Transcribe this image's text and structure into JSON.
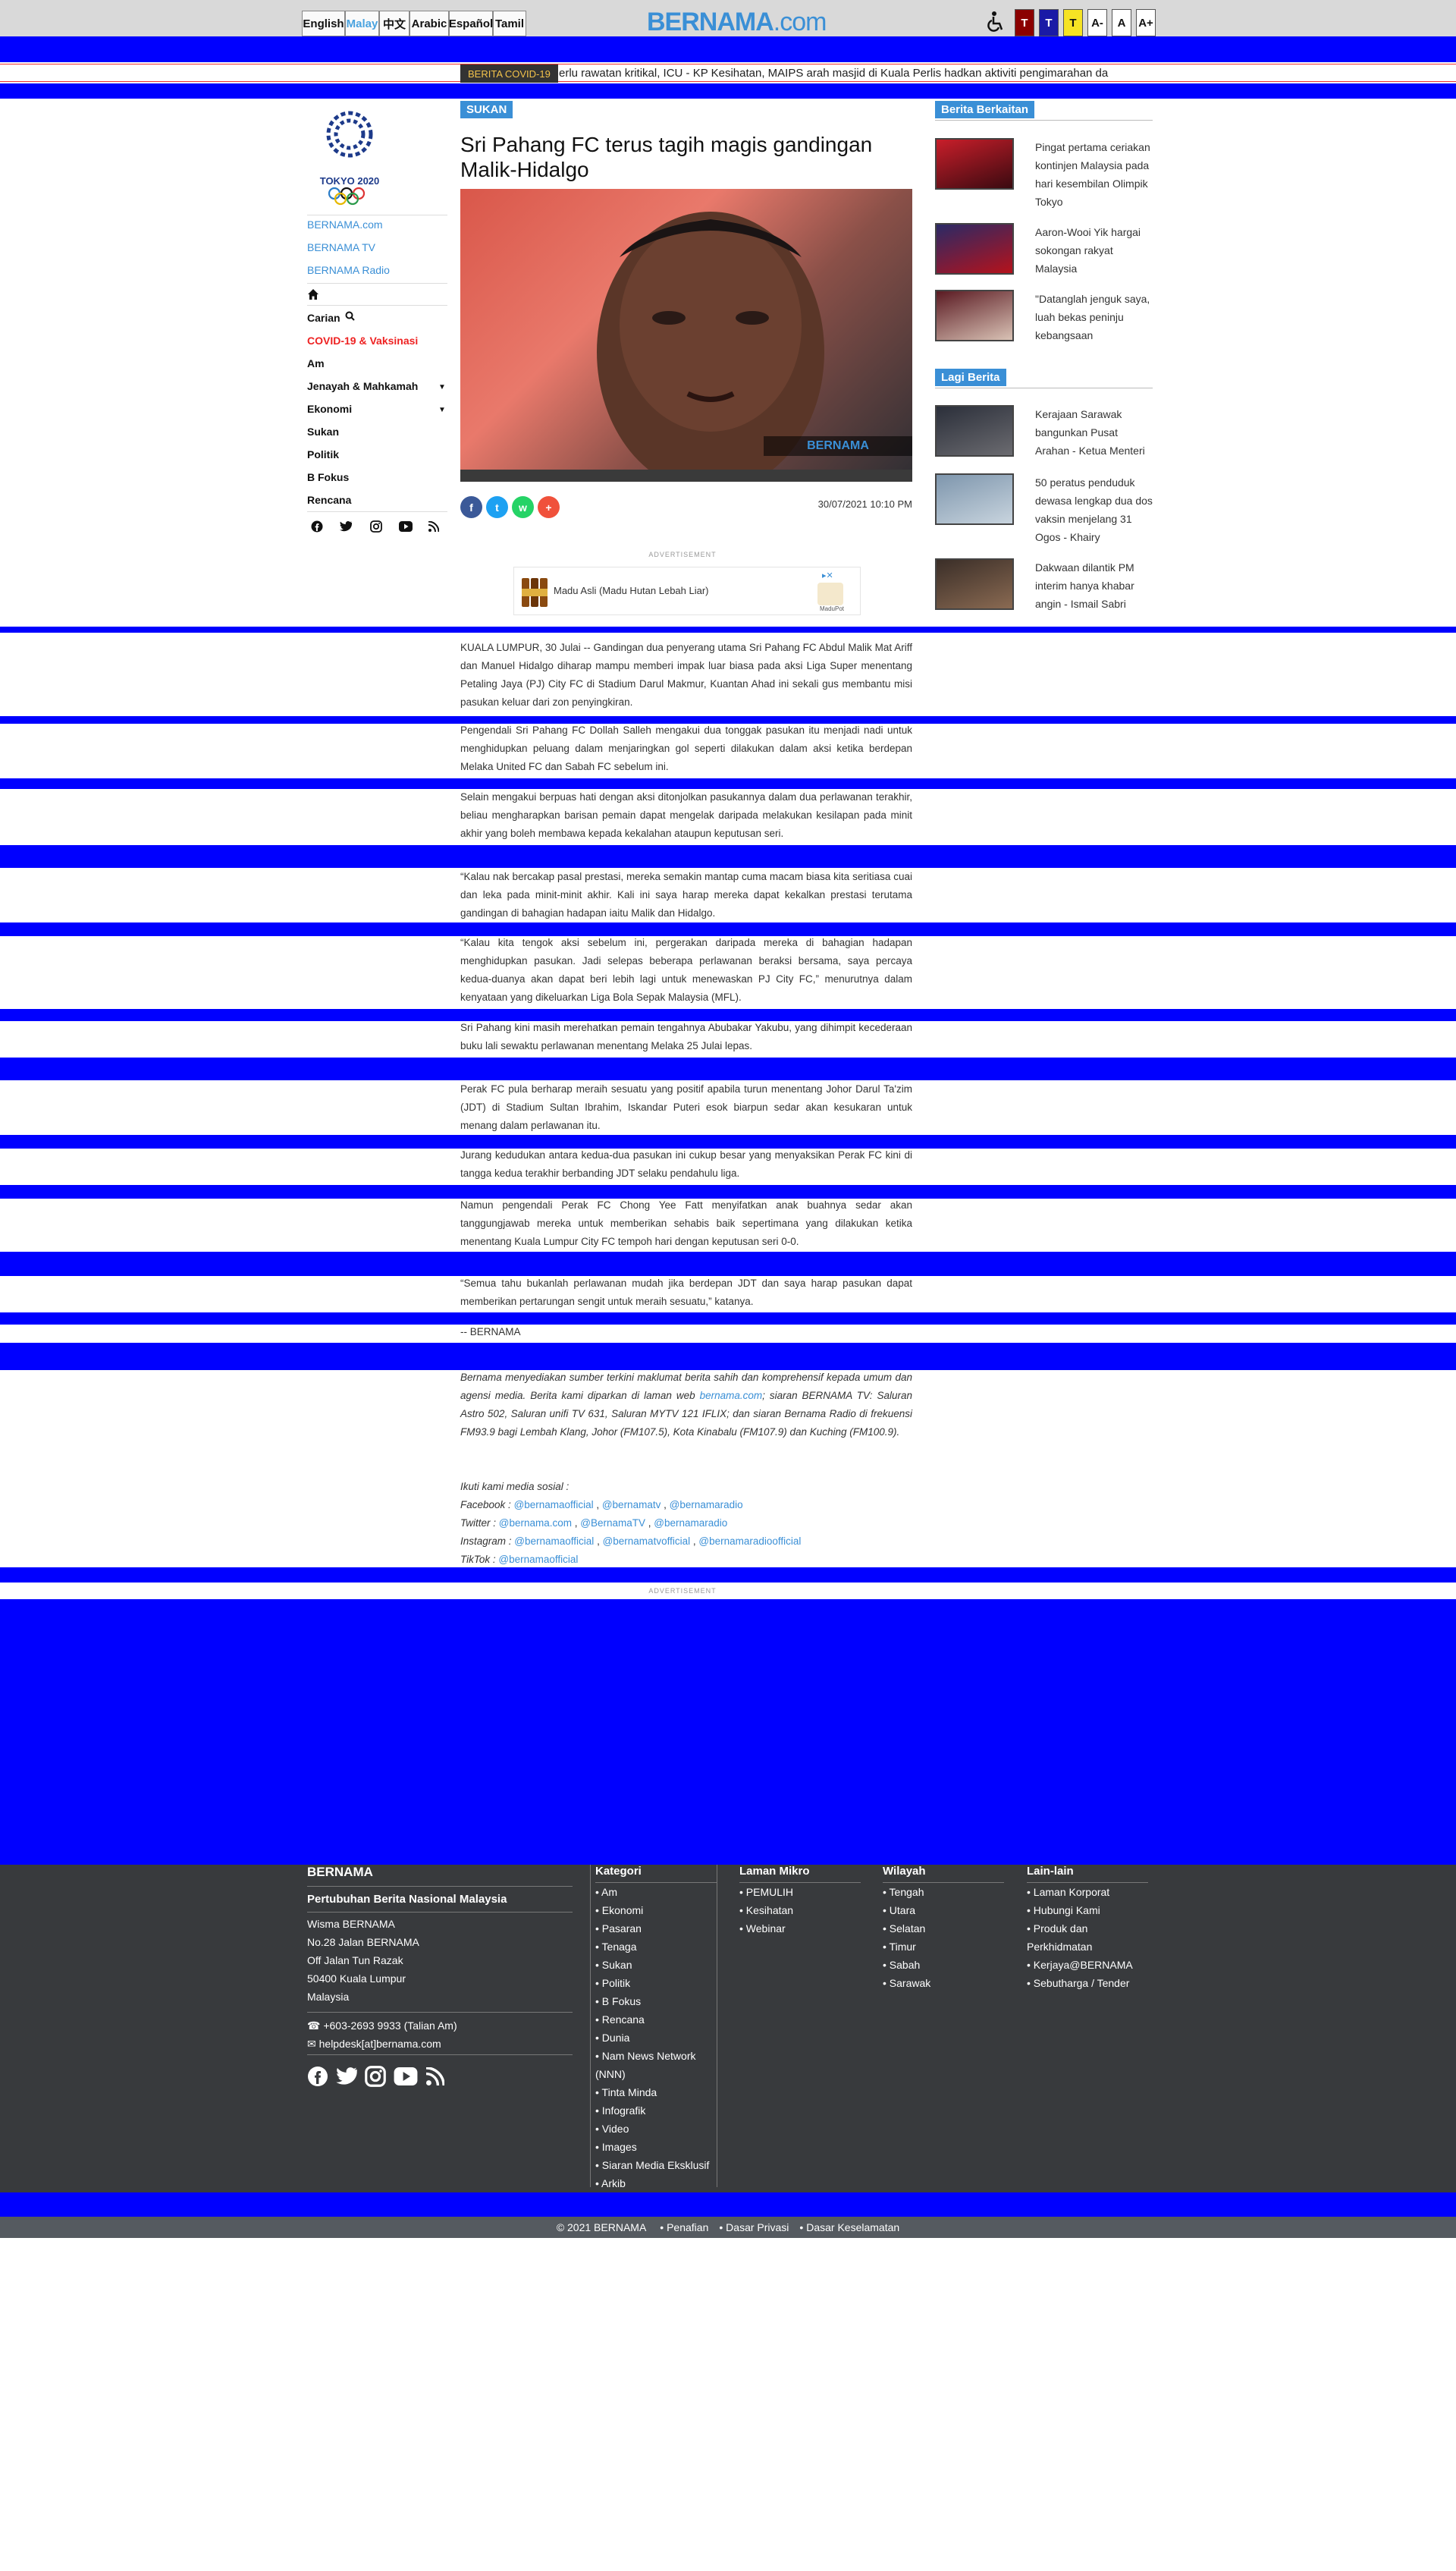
{
  "header": {
    "languages": [
      "English",
      "Malay",
      "中文",
      "Arabic",
      "Español",
      "Tamil"
    ],
    "active_language": "Malay",
    "logo_main": "BERNAMA",
    "logo_suffix": ".com",
    "theme_buttons": [
      "T",
      "T",
      "T",
      "A-",
      "A",
      "A+"
    ],
    "accessibility_icon": "wheelchair-icon"
  },
  "ticker": {
    "label": "BERITA COVID-19",
    "text": "erlu rawatan kritikal, ICU - KP Kesihatan, MAIPS arah masjid di Kuala Perlis hadkan aktiviti pengimarahan da"
  },
  "sidebar": {
    "logo_caption": "TOKYO 2020",
    "links": [
      "BERNAMA.com",
      "BERNAMA TV",
      "BERNAMA Radio"
    ],
    "search_label": "Carian",
    "categories": [
      "COVID-19 & Vaksinasi",
      "Am",
      "Jenayah & Mahkamah",
      "Ekonomi",
      "Sukan",
      "Politik",
      "B Fokus",
      "Rencana"
    ],
    "social_icons": [
      "facebook-icon",
      "twitter-icon",
      "instagram-icon",
      "youtube-icon",
      "rss-icon"
    ]
  },
  "article": {
    "section": "SUKAN",
    "headline": "Sri Pahang FC terus tagih magis gandingan Malik-Hidalgo",
    "image_watermark": "BERNAMA",
    "timestamp": "30/07/2021 10:10 PM",
    "share_icons": [
      "facebook-icon",
      "twitter-icon",
      "whatsapp-icon",
      "plus-icon"
    ],
    "ad_label": "ADVERTISEMENT",
    "ad_text": "Madu Asli (Madu Hutan Lebah Liar)",
    "ad_brand": "MaduPot",
    "paragraphs": [
      "KUALA LUMPUR, 30 Julai -- Gandingan dua penyerang utama Sri Pahang FC Abdul Malik Mat Ariff dan Manuel Hidalgo diharap mampu memberi impak luar biasa pada aksi Liga Super menentang Petaling Jaya (PJ) City FC di Stadium Darul Makmur, Kuantan Ahad ini sekali gus membantu misi pasukan keluar dari zon penyingkiran.",
      "Pengendali Sri Pahang FC Dollah Salleh mengakui dua tonggak pasukan itu menjadi nadi untuk menghidupkan peluang dalam menjaringkan gol seperti dilakukan dalam aksi ketika berdepan Melaka United FC dan Sabah FC sebelum ini.",
      "Selain mengakui berpuas hati dengan aksi ditonjolkan pasukannya dalam dua perlawanan terakhir, beliau mengharapkan barisan pemain dapat mengelak daripada melakukan kesilapan pada minit akhir yang boleh membawa kepada kekalahan ataupun keputusan seri.",
      "“Kalau nak bercakap pasal prestasi, mereka semakin mantap cuma macam biasa kita seritiasa cuai dan leka pada minit-minit akhir. Kali ini saya harap mereka dapat kekalkan prestasi terutama gandingan di bahagian hadapan iaitu Malik dan Hidalgo.",
      "“Kalau kita tengok aksi sebelum ini, pergerakan daripada mereka di bahagian hadapan menghidupkan pasukan. Jadi selepas beberapa perlawanan beraksi bersama, saya percaya kedua-duanya akan dapat beri lebih lagi untuk menewaskan PJ City FC,” menurutnya dalam kenyataan yang dikeluarkan Liga Bola Sepak Malaysia (MFL).",
      "Sri Pahang kini masih merehatkan pemain tengahnya Abubakar Yakubu, yang dihimpit kecederaan buku lali sewaktu perlawanan menentang Melaka 25 Julai lepas.",
      "Perak FC pula berharap meraih sesuatu yang positif apabila turun menentang Johor Darul Ta'zim (JDT) di Stadium Sultan Ibrahim, Iskandar Puteri esok biarpun sedar akan kesukaran untuk menang dalam perlawanan itu.",
      "Jurang kedudukan antara kedua-dua pasukan ini cukup besar yang menyaksikan Perak FC kini di tangga kedua terakhir berbanding JDT selaku pendahulu liga.",
      "Namun pengendali Perak FC Chong Yee Fatt menyifatkan anak buahnya sedar akan tanggungjawab mereka untuk memberikan sehabis baik sepertimana yang dilakukan ketika menentang Kuala Lumpur City FC tempoh hari dengan keputusan seri 0-0.",
      "“Semua tahu bukanlah perlawanan mudah jika berdepan JDT dan saya harap pasukan dapat memberikan pertarungan sengit untuk meraih sesuatu,” katanya.",
      "-- BERNAMA"
    ],
    "disclaimer_prefix": "Bernama menyediakan sumber terkini maklumat berita sahih dan komprehensif kepada umum dan agensi media. Berita kami diparkan di laman web",
    "disclaimer_link": "bernama.com",
    "disclaimer_rest": "; siaran BERNAMA TV: Saluran Astro 502, Saluran unifi TV 631, Saluran MYTV 121 IFLIX; dan siaran Bernama Radio di frekuensi FM93.9 bagi Lembah Klang, Johor (FM107.5), Kota Kinabalu (FM107.9) dan Kuching (FM100.9).",
    "follow_label": "Ikuti kami media sosial :",
    "social_rows": [
      {
        "label": "Facebook :",
        "links": [
          "@bernamaofficial",
          "@bernamatv",
          "@bernamaradio"
        ]
      },
      {
        "label": "Twitter :",
        "links": [
          "@bernama.com",
          "@BernamaTV",
          "@bernamaradio"
        ]
      },
      {
        "label": "Instagram :",
        "links": [
          "@bernamaofficial",
          "@bernamatvofficial",
          "@bernamaradioofficial"
        ]
      },
      {
        "label": "TikTok :",
        "links": [
          "@bernamaofficial"
        ]
      }
    ],
    "bottom_ad_label": "ADVERTISEMENT"
  },
  "related": {
    "title": "Berita Berkaitan",
    "items": [
      "Pingat pertama ceriakan kontinjen Malaysia pada hari kesembilan Olimpik Tokyo",
      "Aaron-Wooi Yik hargai sokongan rakyat Malaysia",
      "\"Datanglah jenguk saya, luah bekas peninju kebangsaan"
    ]
  },
  "latest": {
    "title": "Lagi Berita",
    "items": [
      "Kerajaan Sarawak bangunkan Pusat Arahan - Ketua Menteri",
      "50 peratus penduduk dewasa lengkap dua dos vaksin menjelang 31 Ogos - Khairy",
      "Dakwaan dilantik PM interim hanya khabar angin - Ismail Sabri"
    ]
  },
  "footer": {
    "brand": "BERNAMA",
    "org": "Pertubuhan Berita Nasional Malaysia",
    "address": [
      "Wisma BERNAMA",
      "No.28 Jalan BERNAMA",
      "Off Jalan Tun Razak",
      "50400 Kuala Lumpur",
      "Malaysia"
    ],
    "phone": "+603-2693 9933 (Talian Am)",
    "email": "helpdesk[at]bernama.com",
    "columns": [
      {
        "title": "Kategori",
        "items": [
          "Am",
          "Ekonomi",
          "Pasaran",
          "Tenaga",
          "Sukan",
          "Politik",
          "B Fokus",
          "Rencana",
          "Dunia",
          "Nam News Network (NNN)",
          "Tinta Minda",
          "Infografik",
          "Video",
          "Images",
          "Siaran Media Eksklusif",
          "Arkib"
        ]
      },
      {
        "title": "Laman Mikro",
        "items": [
          "PEMULIH",
          "Kesihatan",
          "Webinar"
        ]
      },
      {
        "title": "Wilayah",
        "items": [
          "Tengah",
          "Utara",
          "Selatan",
          "Timur",
          "Sabah",
          "Sarawak"
        ]
      },
      {
        "title": "Lain-lain",
        "items": [
          "Laman Korporat",
          "Hubungi Kami",
          "Produk dan Perkhidmatan",
          "Kerjaya@BERNAMA",
          "Sebutharga / Tender"
        ]
      }
    ],
    "copyright": "© 2021 BERNAMA",
    "legal_links": [
      "Penafian",
      "Dasar Privasi",
      "Dasar Keselamatan"
    ]
  },
  "colors": {
    "brand_blue": "#3a8fd6",
    "filler_blue": "#0000ff",
    "footer_bg": "#383a3d",
    "ticker_label_bg": "#333333",
    "ticker_label_text": "#f3c34b"
  }
}
